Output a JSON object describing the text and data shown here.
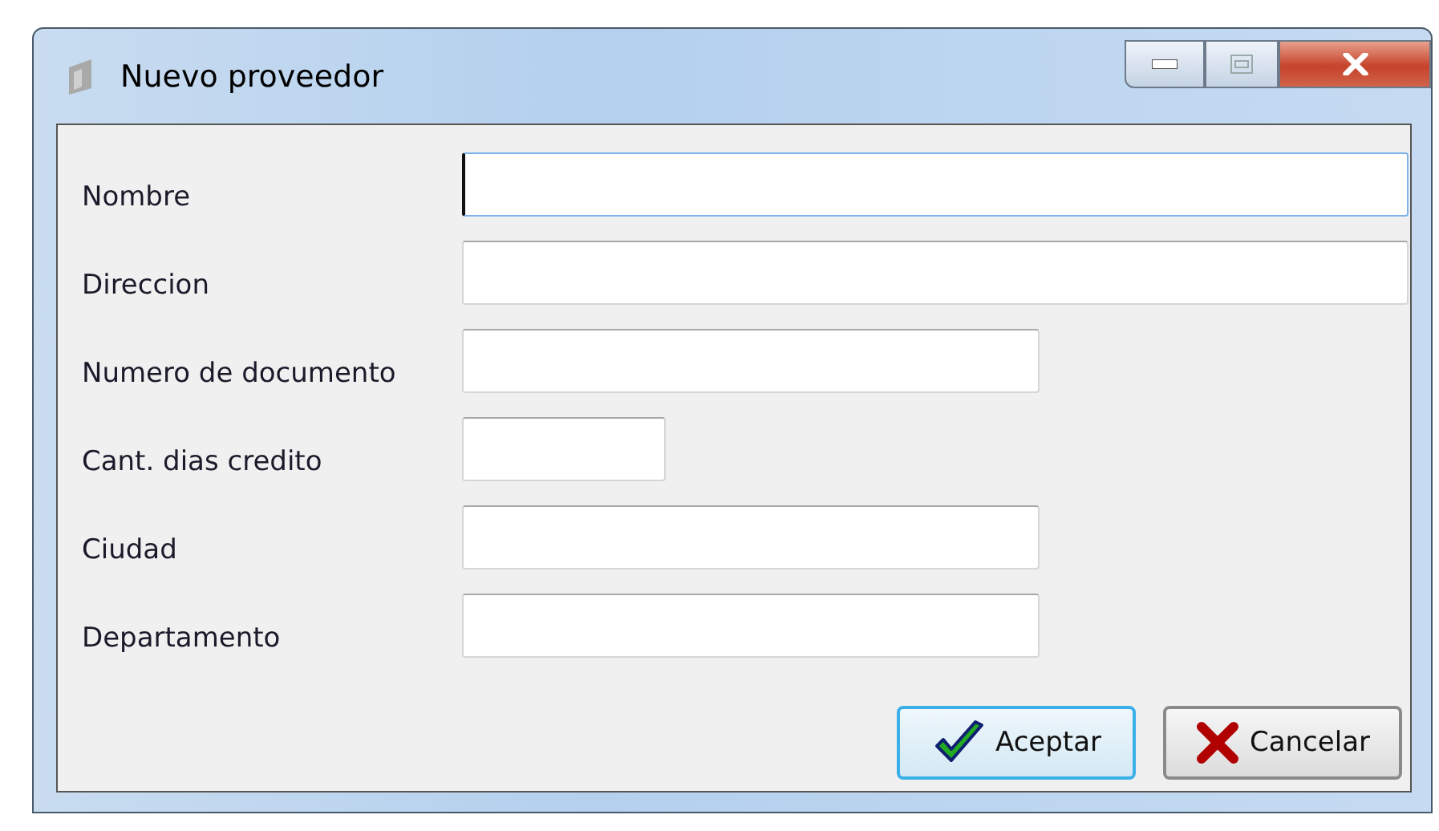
{
  "window": {
    "title": "Nuevo proveedor"
  },
  "fields": [
    {
      "label": "Nombre",
      "kind": "wide",
      "focused": true
    },
    {
      "label": "Direccion",
      "kind": "wide",
      "focused": false
    },
    {
      "label": "Numero de documento",
      "kind": "medium",
      "focused": false
    },
    {
      "label": "Cant. dias credito",
      "kind": "short",
      "focused": false
    },
    {
      "label": "Ciudad",
      "kind": "medium",
      "focused": false
    },
    {
      "label": "Departamento",
      "kind": "medium",
      "focused": false
    }
  ],
  "buttons": [
    {
      "label": "Aceptar",
      "kind": "ok",
      "default": true
    },
    {
      "label": "Cancelar",
      "kind": "cancel",
      "default": false
    }
  ]
}
